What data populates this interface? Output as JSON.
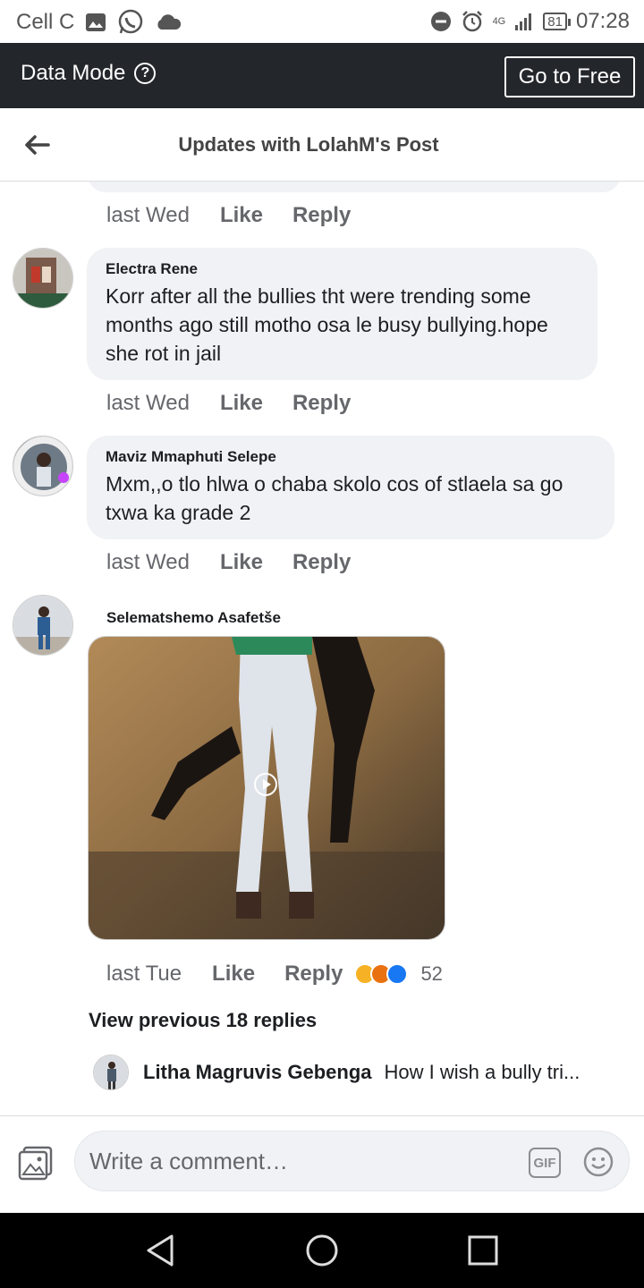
{
  "status_bar": {
    "carrier": "Cell C",
    "network": "4G",
    "battery": "81",
    "time": "07:28"
  },
  "data_bar": {
    "label": "Data Mode",
    "button": "Go to Free"
  },
  "header": {
    "title": "Updates with LolahM's Post"
  },
  "top_meta": {
    "time": "last Wed",
    "like": "Like",
    "reply": "Reply"
  },
  "comments": [
    {
      "author": "Electra Rene",
      "text": "Korr after all the bullies tht were trending some months ago still motho osa  le busy bullying.hope she rot in jail",
      "time": "last Wed",
      "like": "Like",
      "reply": "Reply"
    },
    {
      "author": "Maviz Mmaphuti Selepe",
      "text": "Mxm,,o tlo hlwa o chaba skolo cos of stlaela  sa go txwa ka grade 2",
      "time": "last Wed",
      "like": "Like",
      "reply": "Reply"
    },
    {
      "author": "Selematshemo Asafetše",
      "time": "last Tue",
      "like": "Like",
      "reply": "Reply",
      "reaction_count": "52"
    }
  ],
  "view_previous": "View previous 18 replies",
  "reply_preview": {
    "author": "Litha Magruvis Gebenga",
    "text": "How I wish a bully tri..."
  },
  "composer": {
    "placeholder": "Write a comment…",
    "gif_label": "GIF"
  },
  "colors": {
    "data_bar": "#23262b",
    "bubble": "#f0f2f5",
    "meta_text": "#65676b",
    "like_reaction": "#1877f2",
    "angry_reaction": "#e9710f",
    "sad_reaction": "#f7b125"
  }
}
